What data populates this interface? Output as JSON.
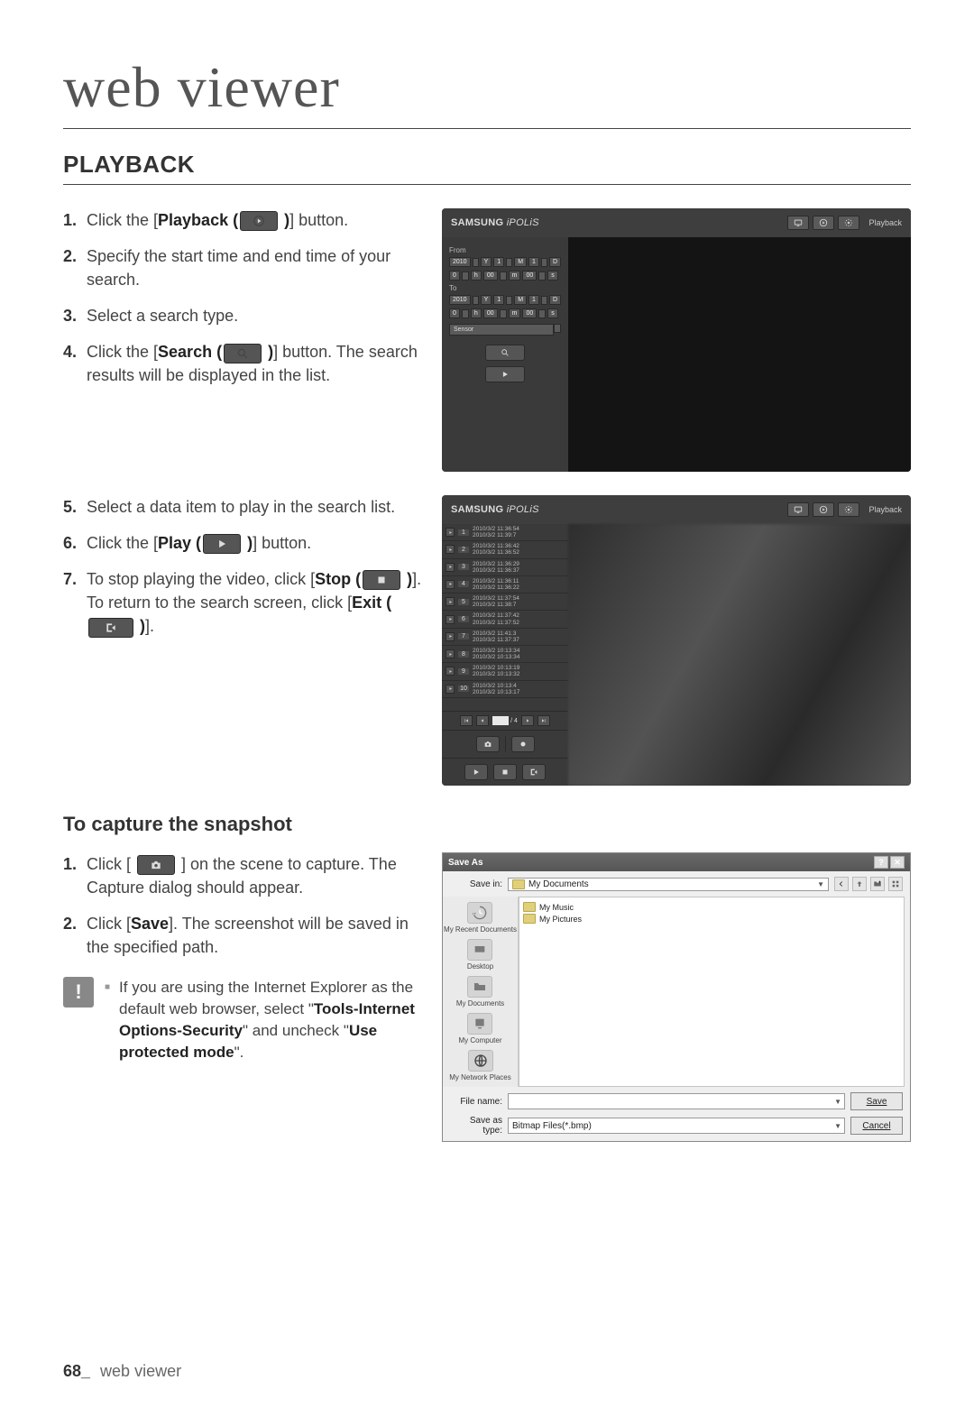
{
  "chapter_title": "web viewer",
  "section_title": "PLAYBACK",
  "steps_a": [
    {
      "pre": "Click the [",
      "bold": "Playback (",
      "icon": "playback",
      "post_bold": " )",
      "post": "] button."
    },
    {
      "pre": "Specify the start time and end time of your search."
    },
    {
      "pre": "Select a search type."
    },
    {
      "pre": "Click the [",
      "bold": "Search (",
      "icon": "search",
      "post_bold": " )",
      "post": "] button. The search results will be displayed in the list."
    }
  ],
  "steps_b": [
    {
      "pre": "Select a data item to play in the search list."
    },
    {
      "pre": "Click the [",
      "bold": "Play (",
      "icon": "play",
      "post_bold": " )",
      "post": "] button."
    },
    {
      "pre": "To stop playing the video, click [",
      "bold": "Stop (",
      "icon": "stop",
      "post_bold": " )",
      "post": "].",
      "extra_pre": "To return to the search screen, click [",
      "extra_bold": "Exit (",
      "extra_icon": "exit",
      "extra_post_bold": " )",
      "extra_post": "]."
    }
  ],
  "subsection_title": "To capture the snapshot",
  "steps_c": [
    {
      "pre": "Click [ ",
      "icon": "camera",
      "post": " ] on the scene to capture. The Capture dialog should appear."
    },
    {
      "pre": "Click [",
      "bold": "Save",
      "post": "]. The screenshot will be saved in the specified path."
    }
  ],
  "note_text_1": "If you are using the Internet Explorer as the default web browser, select \"",
  "note_bold_1": "Tools-Internet Options-Security",
  "note_text_2": "\" and uncheck \"",
  "note_bold_2": "Use protected mode",
  "note_text_3": "\".",
  "fig1": {
    "logo_a": "SAMSUNG ",
    "logo_b": "iPOLiS",
    "header_label": "Playback",
    "from_label": "From",
    "to_label": "To",
    "year": "2010",
    "y": "Y",
    "month": "1",
    "m": "M",
    "day": "1",
    "d": "D",
    "hour": "0",
    "h": "h",
    "min": "00",
    "mm": "m",
    "sec": "00",
    "s": "s",
    "sensor_label": "Sensor"
  },
  "fig2": {
    "logo_a": "SAMSUNG ",
    "logo_b": "iPOLiS",
    "header_label": "Playback",
    "pager_page": "1",
    "pager_total": "/ 4",
    "items": [
      {
        "idx": "1",
        "t1": "2010/3/2 11:36:54",
        "t2": "2010/3/2 11:39:7"
      },
      {
        "idx": "2",
        "t1": "2010/3/2 11:36:42",
        "t2": "2010/3/2 11:36:52"
      },
      {
        "idx": "3",
        "t1": "2010/3/2 11:36:29",
        "t2": "2010/3/2 11:36:37"
      },
      {
        "idx": "4",
        "t1": "2010/3/2 11:36:11",
        "t2": "2010/3/2 11:36:22"
      },
      {
        "idx": "5",
        "t1": "2010/3/2 11:37:54",
        "t2": "2010/3/2 11:38:7"
      },
      {
        "idx": "6",
        "t1": "2010/3/2 11:37:42",
        "t2": "2010/3/2 11:37:52"
      },
      {
        "idx": "7",
        "t1": "2010/3/2 11:41:3",
        "t2": "2010/3/2 11:37:37"
      },
      {
        "idx": "8",
        "t1": "2010/3/2 10:13:34",
        "t2": "2010/3/2 10:13:34"
      },
      {
        "idx": "9",
        "t1": "2010/3/2 10:13:19",
        "t2": "2010/3/2 10:13:32"
      },
      {
        "idx": "10",
        "t1": "2010/3/2 10:13:4",
        "t2": "2010/3/2 10:13:17"
      }
    ]
  },
  "fig3": {
    "title": "Save As",
    "savein_label": "Save in:",
    "savein_value": "My Documents",
    "files": [
      "My Music",
      "My Pictures"
    ],
    "places": [
      "My Recent Documents",
      "Desktop",
      "My Documents",
      "My Computer",
      "My Network Places"
    ],
    "filename_label": "File name:",
    "filename_value": "",
    "savetype_label": "Save as type:",
    "savetype_value": "Bitmap Files(*.bmp)",
    "save_btn": "Save",
    "cancel_btn": "Cancel"
  },
  "footer_page": "68_",
  "footer_text": " web viewer"
}
